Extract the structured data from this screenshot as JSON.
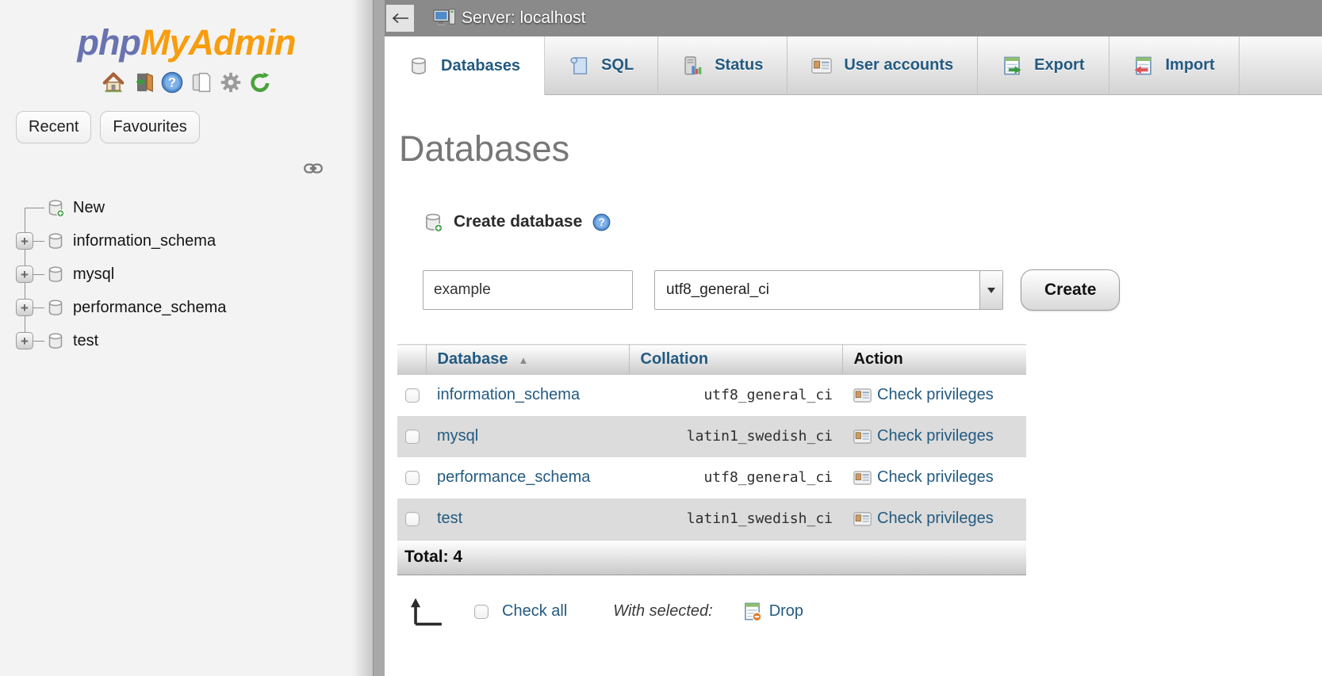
{
  "colors": {
    "link": "#235a81",
    "logo-php": "#6973af",
    "logo-myadmin": "#f89d0e",
    "topbar-bg": "#8a8a8a",
    "row-stripe": "#dcdcdc",
    "title-gray": "#777777"
  },
  "sidebar": {
    "logo_php": "php",
    "logo_myadmin": "MyAdmin",
    "buttons": {
      "recent": "Recent",
      "favourites": "Favourites"
    },
    "tree": {
      "new_label": "New",
      "expander_glyph": "+",
      "items": [
        "information_schema",
        "mysql",
        "performance_schema",
        "test"
      ]
    }
  },
  "topbar": {
    "server_label": "Server: localhost"
  },
  "tabs": [
    {
      "label": "Databases",
      "icon": "database-icon",
      "active": true
    },
    {
      "label": "SQL",
      "icon": "sql-icon",
      "active": false
    },
    {
      "label": "Status",
      "icon": "status-icon",
      "active": false
    },
    {
      "label": "User accounts",
      "icon": "user-accounts-icon",
      "active": false
    },
    {
      "label": "Export",
      "icon": "export-icon",
      "active": false
    },
    {
      "label": "Import",
      "icon": "import-icon",
      "active": false
    }
  ],
  "page": {
    "title": "Databases",
    "create_section": {
      "heading": "Create database"
    },
    "form": {
      "db_name_value": "example",
      "collation_value": "utf8_general_ci",
      "create_button": "Create"
    },
    "table": {
      "headers": {
        "database": "Database",
        "collation": "Collation",
        "action": "Action"
      },
      "sort_indicator": "▲",
      "rows": [
        {
          "database": "information_schema",
          "collation": "utf8_general_ci",
          "action": "Check privileges"
        },
        {
          "database": "mysql",
          "collation": "latin1_swedish_ci",
          "action": "Check privileges"
        },
        {
          "database": "performance_schema",
          "collation": "utf8_general_ci",
          "action": "Check privileges"
        },
        {
          "database": "test",
          "collation": "latin1_swedish_ci",
          "action": "Check privileges"
        }
      ],
      "total": "Total: 4"
    },
    "footer": {
      "check_all": "Check all",
      "with_selected": "With selected:",
      "drop": "Drop"
    }
  }
}
